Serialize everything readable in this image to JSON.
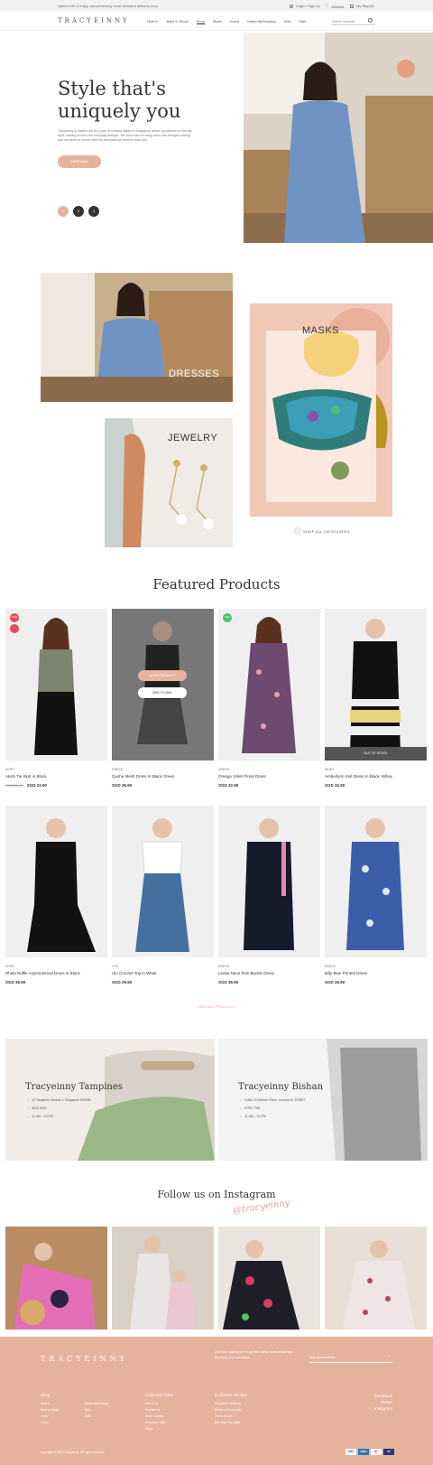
{
  "topbar": {
    "promo": "Spend 100 & enjoy complimentary local standard delivery now!",
    "login": "Login / Sign up",
    "wishlist": "Wishlist",
    "bag": "My Bag (0)"
  },
  "nav": {
    "logo": "TRACYEINNY",
    "items": [
      "New In",
      "Back in Stock",
      "Shop",
      "Mask",
      "Curve",
      "Maternity/Nursing",
      "Kids",
      "Sale"
    ],
    "active_index": 2,
    "search_placeholder": "Search keyword"
  },
  "hero": {
    "title_line1": "Style that's",
    "title_line2": "uniquely you",
    "description": "Tracyeinny is started out by a pair of cousins based in Singapore driven by passion to find the right clothing to suit your everyday lifestyle. We work hard to bring fresh new designs weekly, and we strive to evolve with the feedback we receive from you.",
    "cta": "SHOP NOW",
    "slides": [
      "1",
      "2",
      "3"
    ]
  },
  "categories": {
    "dresses": "DRESSES",
    "masks": "MASKS",
    "jewelry": "JEWELRY",
    "shop_all": "SHOP ALL CATEGORIES"
  },
  "featured": {
    "title": "Featured Products",
    "quick_view": "QUICK PRODUCT",
    "add_to_bag": "ADD TO BAG",
    "out_of_stock": "OUT OF STOCK",
    "badge_sale": "SALE",
    "badge_new": "NEW",
    "view_all": "VIEW ALL PRODUCTS",
    "products": [
      {
        "cat": "SKIRT",
        "name": "Akshi Tie Skirt in Black",
        "old": "SGD 35.90",
        "price": "SGD 22.90"
      },
      {
        "cat": "DRESS",
        "name": "Qusha Mesh Dress In Black Green",
        "old": "",
        "price": "SGD 36.90"
      },
      {
        "cat": "DRESS",
        "name": "Omega Violet Floral Dress",
        "old": "",
        "price": "SGD 32.90"
      },
      {
        "cat": "SKIRT",
        "name": "Amberlynn Knit Dress In Black Yellow",
        "old": "",
        "price": "SGD 32.90"
      },
      {
        "cat": "SKIRT",
        "name": "Rhela Ruffle Asymmetrical Dress in Black",
        "old": "",
        "price": "SGD 36.90"
      },
      {
        "cat": "TOP",
        "name": "Ulu Crochet Top in White",
        "old": "",
        "price": "SGD 29.90"
      },
      {
        "cat": "DRESS",
        "name": "Lenka Neon Pink Buckle Dress",
        "old": "",
        "price": "SGD 36.90"
      },
      {
        "cat": "DRESS",
        "name": "Billy Blue Printed Dress",
        "old": "",
        "price": "SGD 36.90"
      }
    ]
  },
  "stores": [
    {
      "name": "Tracyeinny Tampines",
      "address": "10 Tampines Central 1, Singapore 529536",
      "phone": "6010 6363",
      "hours": "11 AM – 10 PM"
    },
    {
      "name": "Tracyeinny Bishan",
      "address": "9 #B1-10 Bishan Place, Junction 8, 579837",
      "phone": "8798 7758",
      "hours": "11 AM – 10 PM"
    }
  ],
  "instagram": {
    "title": "Follow us on Instagram",
    "handle": "@tracyeinny"
  },
  "footer": {
    "logo": "TRACYEINNY",
    "newsletter": "Join our mailing list to get the latest news about our products & promotions",
    "email_placeholder": "Your email address",
    "social": [
      "Facebook",
      "Twitter",
      "Instagram"
    ],
    "columns": [
      {
        "title": "Shop",
        "items": [
          "New In",
          "Back in Stock",
          "Mask",
          "Curve"
        ]
      },
      {
        "title": "",
        "items": [
          "Maternity/Nursing",
          "Kids",
          "Sale"
        ]
      },
      {
        "title": "Customer Care",
        "items": [
          "About Us",
          "Contact Us",
          "Store Locator",
          "Customer Care",
          "FAQs"
        ]
      },
      {
        "title": "Customer Service",
        "items": [
          "Shipping & Delivery",
          "Return & Exchanges",
          "Terms of Use",
          "Buy Now Pay Later"
        ]
      }
    ],
    "copyright": "Copyright © 2020 Tracyeinny. All rights reserved.",
    "payments": [
      "VISA",
      "AMEX",
      "MC",
      "PP"
    ]
  },
  "colors": {
    "accent": "#e5b39c",
    "dark": "#333333",
    "sale": "#e84c5c",
    "new": "#4cc26b"
  }
}
